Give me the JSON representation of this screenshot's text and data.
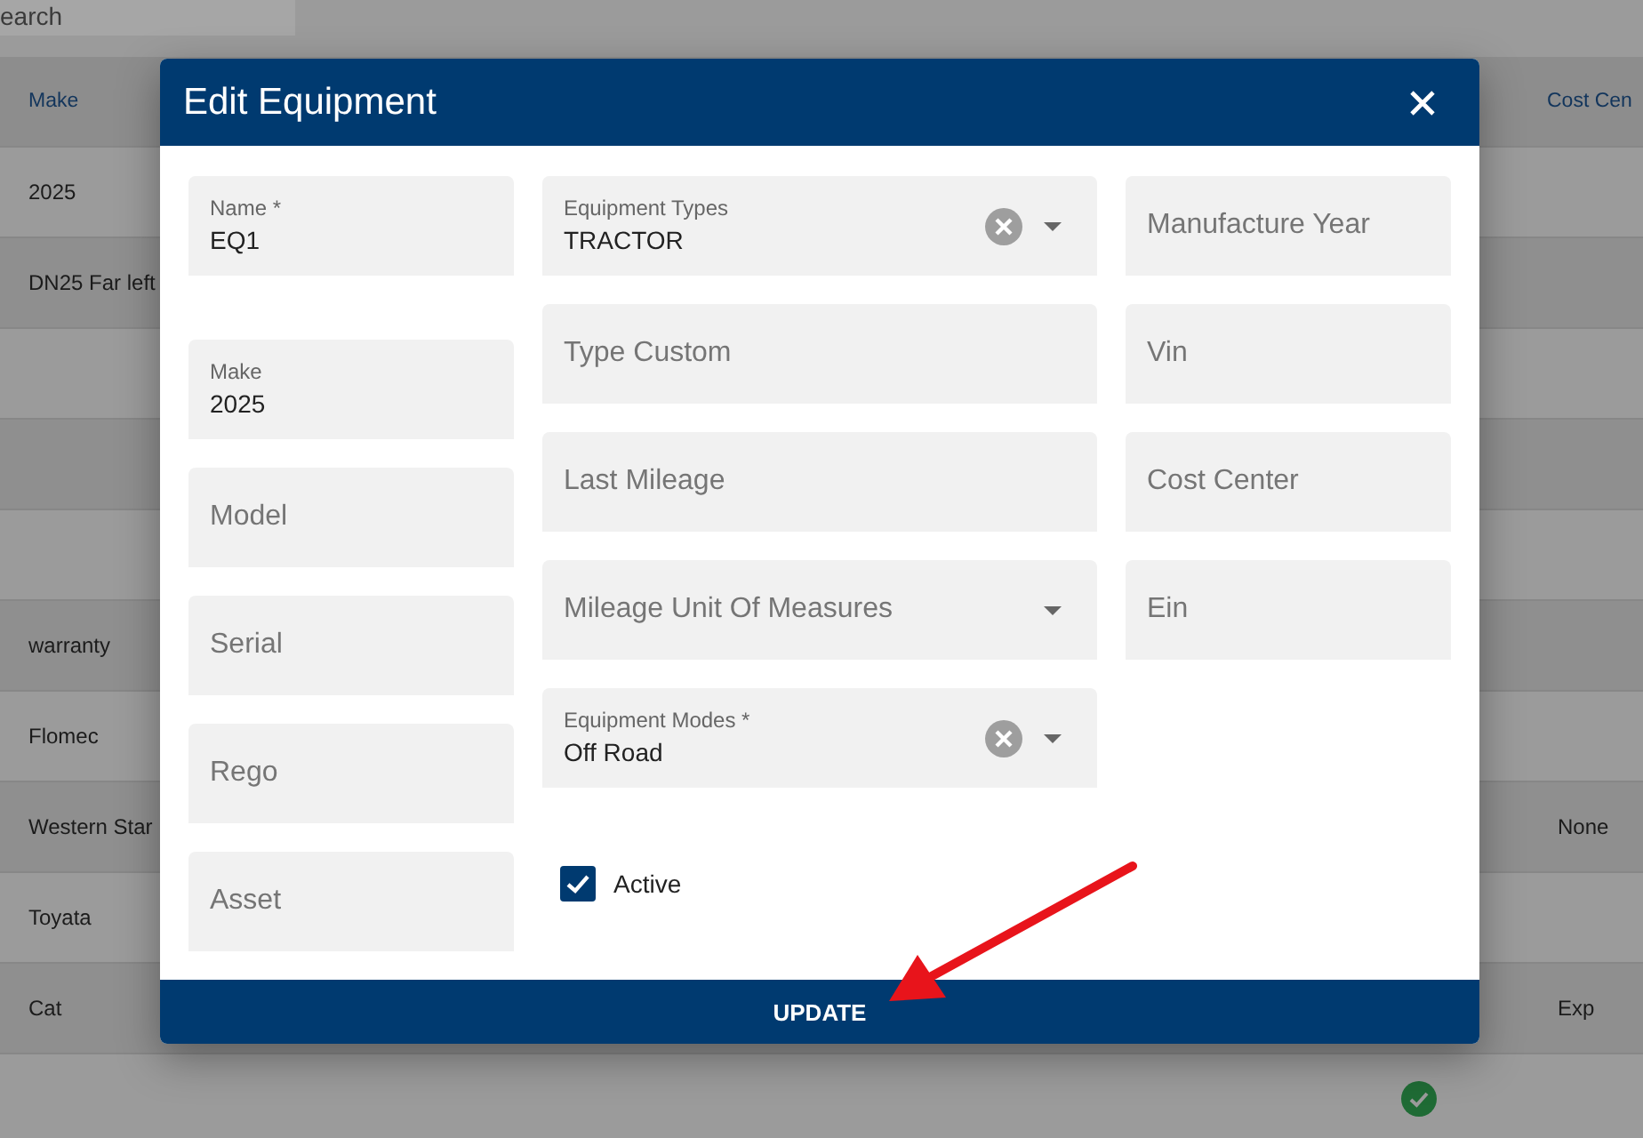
{
  "background": {
    "search": {
      "placeholder": "earch"
    },
    "table": {
      "columns": [
        {
          "label": "Make"
        },
        {
          "label": "Cost Cen"
        }
      ],
      "rows": [
        {
          "make": "2025",
          "active": false
        },
        {
          "make": "DN25 Far left",
          "active": false
        },
        {
          "active": false
        },
        {
          "active": false
        },
        {
          "active": false
        },
        {
          "make": "warranty",
          "active": false
        },
        {
          "make": "Flomec",
          "active": false
        },
        {
          "make": "Western Star",
          "cost_center": "None",
          "active": false
        },
        {
          "make": "Toyata",
          "active": false
        },
        {
          "make": "Cat",
          "cost_center": "Exp",
          "active": false
        },
        {
          "active": true
        }
      ]
    }
  },
  "dialog": {
    "title": "Edit Equipment",
    "columns": [
      [
        {
          "kind": "text",
          "label": "Name *",
          "value": "EQ1"
        },
        {
          "kind": "text",
          "label": "Make",
          "value": "2025"
        },
        {
          "kind": "text",
          "label": "Model"
        },
        {
          "kind": "text",
          "label": "Serial"
        },
        {
          "kind": "text",
          "label": "Rego"
        },
        {
          "kind": "text",
          "label": "Asset"
        }
      ],
      [
        {
          "kind": "select",
          "label": "Equipment Types",
          "value": "TRACTOR",
          "clearable": true
        },
        {
          "kind": "text",
          "label": "Type Custom"
        },
        {
          "kind": "text",
          "label": "Last Mileage"
        },
        {
          "kind": "select",
          "label": "Mileage Unit Of Measures",
          "clearable": false
        },
        {
          "kind": "select",
          "label": "Equipment Modes *",
          "value": "Off Road",
          "clearable": true
        },
        {
          "kind": "checkbox",
          "label": "Active",
          "checked": true
        }
      ],
      [
        {
          "kind": "text",
          "label": "Manufacture Year"
        },
        {
          "kind": "text",
          "label": "Vin"
        },
        {
          "kind": "text",
          "label": "Cost Center"
        },
        {
          "kind": "text",
          "label": "Ein"
        }
      ]
    ],
    "update_button": "UPDATE"
  },
  "annotation": {
    "kind": "arrow"
  }
}
